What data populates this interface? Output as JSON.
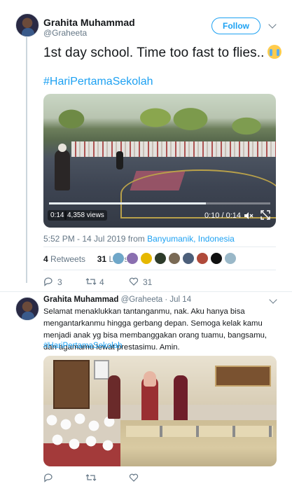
{
  "main_tweet": {
    "author_name": "Grahita Muhammad",
    "author_handle": "@Graheeta",
    "follow_label": "Follow",
    "text": "1st day school. Time too fast to flies..",
    "emoji": "loudly-crying-face-emoji",
    "hashtag": "#HariPertamaSekolah",
    "video": {
      "elapsed": "0:14",
      "views": "4,358 views",
      "time": "0:10 / 0:14",
      "progress": 0.71
    },
    "timestamp": "5:52 PM - 14 Jul 2019 from",
    "location": "Banyumanik, Indonesia",
    "retweets_count": "4",
    "retweets_label": "Retweets",
    "likes_count": "31",
    "likes_label": "Likes",
    "actions": {
      "reply_count": "3",
      "retweet_count": "4",
      "like_count": "31"
    }
  },
  "reply_tweet": {
    "author_name": "Grahita Muhammad",
    "author_handle": "@Graheeta",
    "date": "· Jul 14",
    "text": "Selamat menaklukkan tantanganmu, nak. Aku hanya bisa mengantarkanmu hingga gerbang depan. Semoga kelak kamu menjadi anak yg bisa membanggakan orang tuamu, bangsamu, dan agamamu lewat prestasimu. Amin.",
    "hashtag": "#HariPertamaSekolah"
  },
  "colors": {
    "accent": "#1da1f2",
    "text_secondary": "#657786",
    "divider": "#e6ecf0"
  }
}
